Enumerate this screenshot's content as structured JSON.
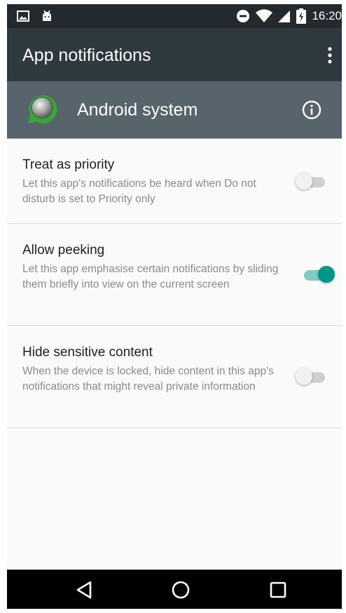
{
  "status_bar": {
    "time": "16:20",
    "left_icons": [
      "image-icon",
      "android-icon"
    ],
    "right_icons": [
      "do-not-disturb-icon",
      "wifi-icon",
      "signal-icon",
      "battery-charging-icon"
    ]
  },
  "toolbar": {
    "title": "App notifications",
    "menu_icon": "more-vert-icon"
  },
  "app_header": {
    "name": "Android system",
    "icon": "android-system-icon",
    "info_icon": "info-icon"
  },
  "settings": [
    {
      "title": "Treat as priority",
      "subtitle": "Let this app's notifications be heard when Do not disturb is set to Priority only",
      "enabled": false
    },
    {
      "title": "Allow peeking",
      "subtitle": "Let this app emphasise certain notifications by sliding them briefly into view on the current screen",
      "enabled": true
    },
    {
      "title": "Hide sensitive content",
      "subtitle": "When the device is locked, hide content in this app's notifications that might reveal private information",
      "enabled": false
    }
  ],
  "navbar": {
    "icons": [
      "back-icon",
      "home-icon",
      "recents-icon"
    ]
  },
  "colors": {
    "status_bar": "#24292d",
    "toolbar": "#2f3a40",
    "app_header": "#58646b",
    "accent": "#009688",
    "accent_light": "#80cbc4"
  }
}
